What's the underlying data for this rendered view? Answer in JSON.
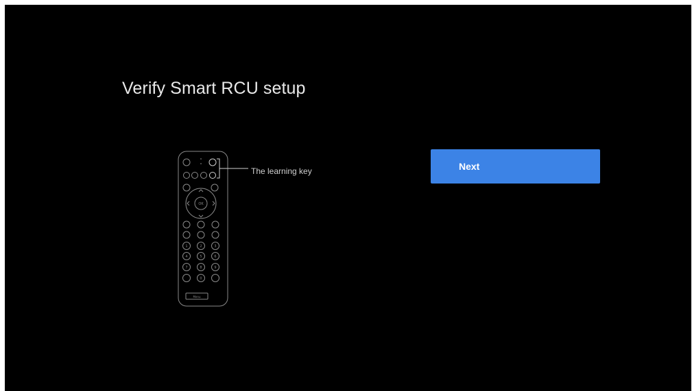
{
  "screen": {
    "title": "Verify Smart RCU setup",
    "next_button_label": "Next",
    "accent_color": "#3c83e6",
    "background_color": "#000000"
  },
  "remote": {
    "learning_key_label": "The learning key",
    "ok_label": "OK",
    "brand_label": "Menu"
  }
}
